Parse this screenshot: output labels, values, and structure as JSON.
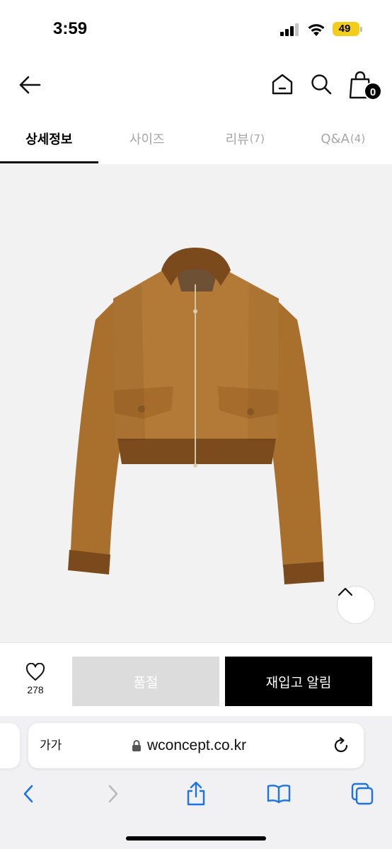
{
  "status_bar": {
    "time": "3:59",
    "battery_level": "49",
    "battery_color": "#f2cd1a"
  },
  "header": {
    "icons": [
      "back-arrow-icon",
      "home-icon",
      "search-icon",
      "shopping-bag-icon"
    ],
    "cart_count": "0"
  },
  "tabs": [
    {
      "label": "상세정보",
      "count": "",
      "active": true
    },
    {
      "label": "사이즈",
      "count": "",
      "active": false
    },
    {
      "label": "리뷰",
      "count": "(7)",
      "active": false
    },
    {
      "label": "Q&A",
      "count": "(4)",
      "active": false
    }
  ],
  "product": {
    "image_icon": "suede-bomber-jacket-image",
    "image_background": "#f2f2f2",
    "jacket_color": "#b07a34"
  },
  "purchase_bar": {
    "like_count": "278",
    "soldout_label": "품절",
    "restock_label": "재입고 알림"
  },
  "browser": {
    "text_size_label": "가가",
    "url": "wconcept.co.kr",
    "accent_color": "#1a73e8"
  }
}
